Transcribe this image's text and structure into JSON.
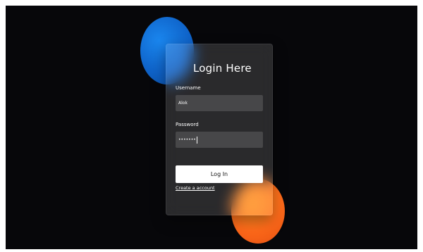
{
  "login": {
    "title": "Login Here",
    "username_label": "Username",
    "username_value": "Alok",
    "password_label": "Password",
    "password_value": "•••••••",
    "login_button": "Log In",
    "create_account_link": "Create a account"
  },
  "colors": {
    "background": "#07070a",
    "blob_blue": "#0f63c9",
    "blob_orange": "#ff6a1a",
    "button_bg": "#ffffff"
  }
}
